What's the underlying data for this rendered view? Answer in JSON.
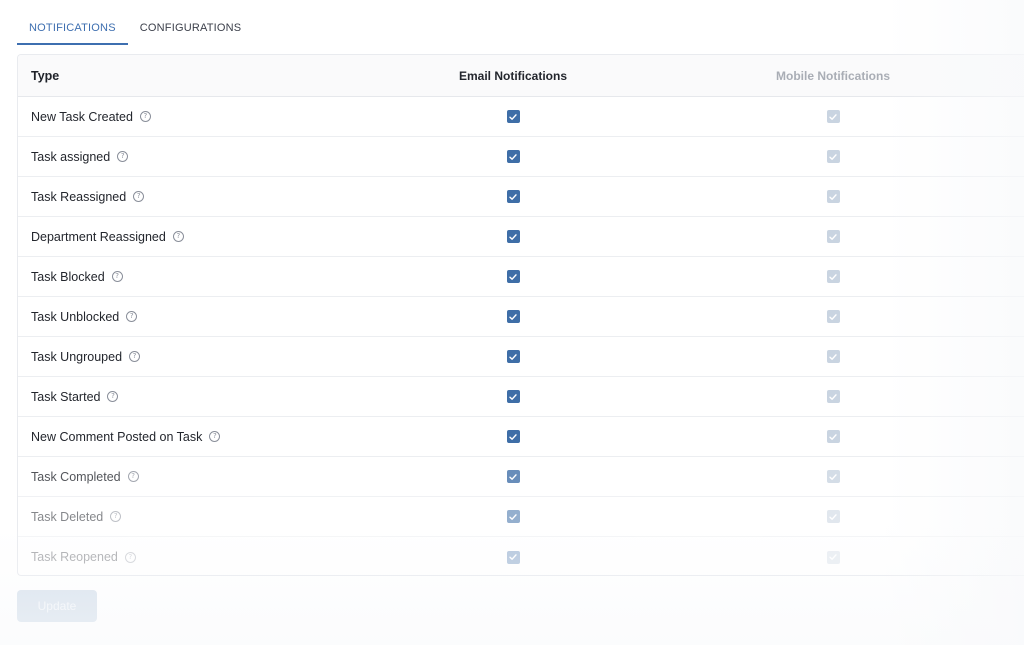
{
  "tabs": [
    {
      "label": "NOTIFICATIONS",
      "active": true
    },
    {
      "label": "CONFIGURATIONS",
      "active": false
    }
  ],
  "table": {
    "headers": {
      "type": "Type",
      "email": "Email Notifications",
      "mobile": "Mobile Notifications"
    },
    "rows": [
      {
        "type": "New Task Created",
        "email": true,
        "mobile": true
      },
      {
        "type": "Task assigned",
        "email": true,
        "mobile": true
      },
      {
        "type": "Task Reassigned",
        "email": true,
        "mobile": true
      },
      {
        "type": "Department Reassigned",
        "email": true,
        "mobile": true
      },
      {
        "type": "Task Blocked",
        "email": true,
        "mobile": true
      },
      {
        "type": "Task Unblocked",
        "email": true,
        "mobile": true
      },
      {
        "type": "Task Ungrouped",
        "email": true,
        "mobile": true
      },
      {
        "type": "Task Started",
        "email": true,
        "mobile": true
      },
      {
        "type": "New Comment Posted on Task",
        "email": true,
        "mobile": true
      },
      {
        "type": "Task Completed",
        "email": true,
        "mobile": true
      },
      {
        "type": "Task Deleted",
        "email": true,
        "mobile": true
      },
      {
        "type": "Task Reopened",
        "email": true,
        "mobile": true
      }
    ]
  },
  "actions": {
    "update_label": "Update"
  },
  "icons": {
    "help": "question-circle-icon",
    "check": "checkmark-icon"
  },
  "colors": {
    "accent": "#3e6fb0",
    "checkbox_checked": "#3e6ea7",
    "checkbox_disabled": "#c9d4e1",
    "button_disabled": "#d8e2ed"
  }
}
